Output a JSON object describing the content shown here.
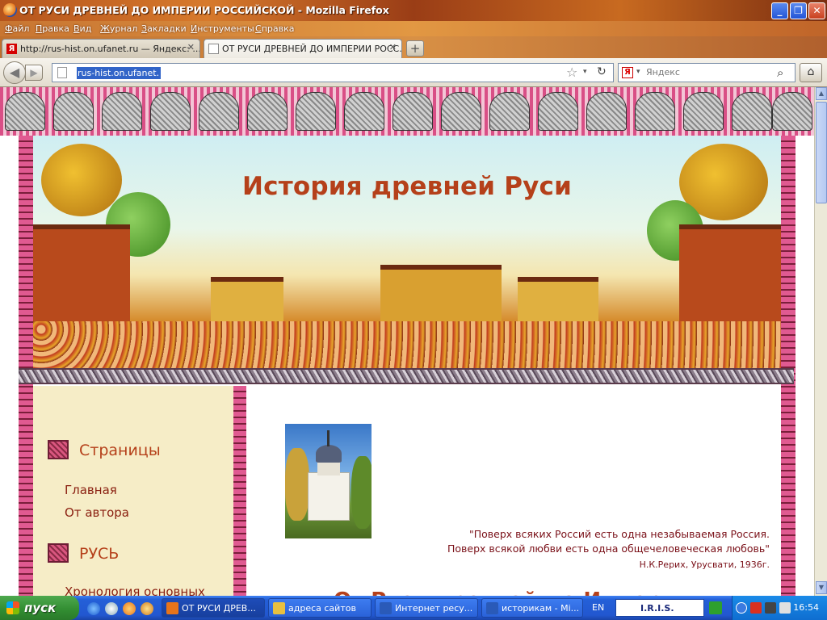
{
  "window": {
    "title": "ОТ РУСИ ДРЕВНЕЙ ДО ИМПЕРИИ РОССИЙСКОЙ - Mozilla Firefox",
    "min_label": "_",
    "max_label": "❐",
    "close_label": "✕"
  },
  "menu": [
    "Файл",
    "Правка",
    "Вид",
    "Журнал",
    "Закладки",
    "Инструменты",
    "Справка"
  ],
  "tabs": [
    {
      "label": "http://rus-hist.on.ufanet.ru — Яндекс: ...",
      "fav": "Я",
      "close": "✕"
    },
    {
      "label": "ОТ РУСИ ДРЕВНЕЙ ДО ИМПЕРИИ РОСС...",
      "close": "✕"
    }
  ],
  "newtab_label": "+",
  "nav": {
    "back": "◀",
    "forward": "▶",
    "url": "rus-hist.on.ufanet.ru",
    "star": "☆",
    "dropdown": "▾",
    "reload": "↻",
    "search_engine": "Я",
    "search_placeholder": "Яндекс",
    "search_glass": "⌕",
    "home": "⌂"
  },
  "page": {
    "site_title": "История древней Руси",
    "sidebar": {
      "sections": [
        {
          "title": "Страницы",
          "links": [
            "Главная",
            "От автора"
          ]
        },
        {
          "title": "РУСЬ",
          "links": [
            "Хронология основных"
          ]
        }
      ]
    },
    "quote_lines": [
      "\"Поверх всяких Россий есть одна незабываемая Россия.",
      "Поверх всякой любви есть одна общечеловеческая любовь\""
    ],
    "quote_author": "Н.К.Рерих, Урусвати, 1936г.",
    "heading_partial": "От Руси древней до Империи"
  },
  "scrollbar": {
    "up": "▲",
    "down": "▼"
  },
  "taskbar": {
    "start": "пуск",
    "tasks": [
      {
        "label": "ОТ РУСИ ДРЕВ...",
        "active": true,
        "color": "#e8741a"
      },
      {
        "label": "адреса сайтов",
        "active": false,
        "color": "#e8c040"
      },
      {
        "label": "Интернет ресу...",
        "active": false,
        "color": "#2a5ab8"
      },
      {
        "label": "историкам - Mi...",
        "active": false,
        "color": "#2a5ab8"
      }
    ],
    "lang": "EN",
    "iris": "I.R.I.S.",
    "clock": "16:54"
  }
}
